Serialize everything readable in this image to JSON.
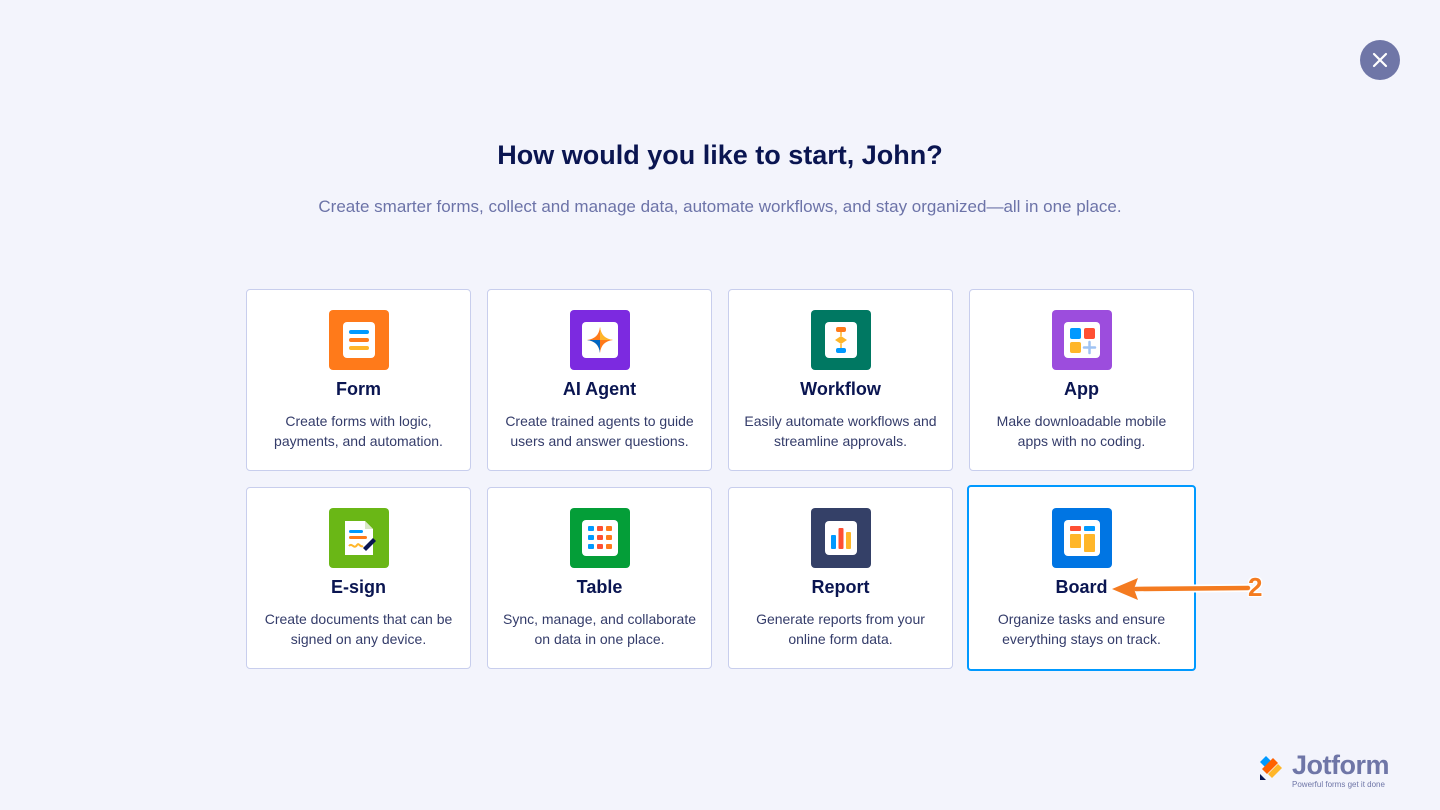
{
  "header": {
    "title": "How would you like to start, John?",
    "subtitle": "Create smarter forms, collect and manage data, automate workflows, and stay organized—all in one place."
  },
  "close": {
    "icon": "close-icon"
  },
  "cards": [
    {
      "name": "Form",
      "desc1": "Create forms with logic,",
      "desc2": "payments, and automation.",
      "icon": "form-icon",
      "color": "#ff7a1a"
    },
    {
      "name": "AI Agent",
      "desc1": "Create trained agents to guide",
      "desc2": "users and answer questions.",
      "icon": "ai-agent-icon",
      "color": "#7c2ae0"
    },
    {
      "name": "Workflow",
      "desc1": "Easily automate workflows and",
      "desc2": "streamline approvals.",
      "icon": "workflow-icon",
      "color": "#007862"
    },
    {
      "name": "App",
      "desc1": "Make downloadable mobile",
      "desc2": "apps with no coding.",
      "icon": "app-icon",
      "color": "#9c4ddd"
    },
    {
      "name": "E-sign",
      "desc1": "Create documents that can be",
      "desc2": "signed on any device.",
      "icon": "esign-icon",
      "color": "#6ab716"
    },
    {
      "name": "Table",
      "desc1": "Sync, manage, and collaborate",
      "desc2": "on data in one place.",
      "icon": "table-icon",
      "color": "#049e38"
    },
    {
      "name": "Report",
      "desc1": "Generate reports from your",
      "desc2": "online form data.",
      "icon": "report-icon",
      "color": "#344067"
    },
    {
      "name": "Board",
      "desc1": "Organize tasks and ensure",
      "desc2": "everything stays on track.",
      "icon": "board-icon",
      "color": "#0075e3"
    }
  ],
  "annotation": {
    "step": "2",
    "color": "#f47b20"
  },
  "brand": {
    "name": "Jotform",
    "tagline": "Powerful forms get it done"
  }
}
